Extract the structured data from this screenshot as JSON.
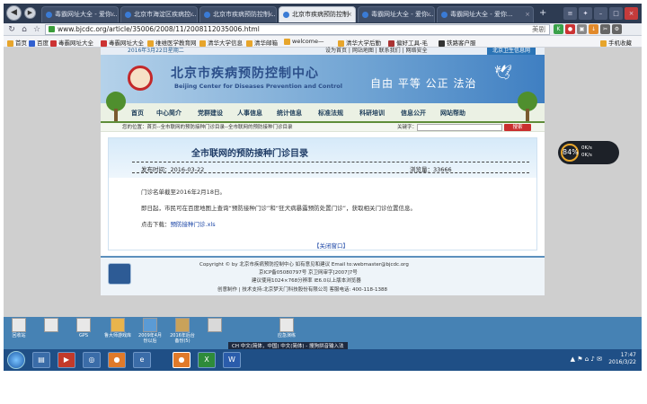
{
  "browser": {
    "tabs": [
      {
        "label": "毒霸网址大全 - 爱你..."
      },
      {
        "label": "北京市海淀区疾病控..."
      },
      {
        "label": "北京市疾病预防控制..."
      },
      {
        "label": "北京市疾病预防控制"
      },
      {
        "label": "毒霸网址大全 - 爱你..."
      },
      {
        "label": "毒霸网址大全 - 爱你..."
      }
    ],
    "active_tab": 3,
    "url": "www.bjcdc.org/article/35006/2008/11/2008112035006.html",
    "url_right_hint": "美剧",
    "bookmarks": [
      "首页",
      "百度",
      "毒霸网址大全",
      "毒霸网址大全",
      "维维医学教育网",
      "清华大学信息",
      "清华邮箱",
      "welcome—",
      "清华大学后勤",
      "偏好工具-毛",
      "铁路客户服",
      "手机收藏"
    ]
  },
  "site": {
    "date": "2016年3月22日星期二",
    "top_links": "设为首页 | 网站地图 | 联系我们 | 网络安全",
    "brand": "北京卫生信息网",
    "title_zh": "北京市疾病预防控制中心",
    "title_en": "Beijing Center for Diseases Prevention and Control",
    "slogan": "自由 平等 公正 法治",
    "nav": [
      "首页",
      "中心简介",
      "党群建设",
      "人事信息",
      "统计信息",
      "标准法规",
      "科研培训",
      "信息公开",
      "网站帮助"
    ],
    "breadcrumb": "您的位置：首页--全市联网的预防接种门诊目录--全市联网的预防接种门诊目录",
    "keyword_label": "关键字：",
    "search_button": "搜索"
  },
  "article": {
    "title": "全市联网的预防接种门诊目录",
    "published": "发布时间：2016-03-22",
    "views": "浏览量：33666",
    "para1": "门诊名单截至2016年2月18日。",
    "para2": "即日起，市民可在百度地图上查询“预防接种门诊”和“狂犬病暴露预防处置门诊”，获取相关门诊位置信息。",
    "download_label": "点击下载：",
    "download_link": "预防接种门诊.xls",
    "close_link": "【关闭窗口】"
  },
  "footer": {
    "line1": "Copyright © by 北京市疾病预防控制中心 如有意见和建议 Email to:webmaster@bjcdc.org",
    "line2": "京ICP备05080797号  京卫网审字[2007]7号",
    "line3": "建议使用1024×768分辨率 IE6.0以上版本浏览器",
    "line4": "创意制作 | 技术支持:北京梦天门科技股份有限公司 客服电话: 400-118-1388"
  },
  "widget": {
    "percent": "84%",
    "up": "0K/s",
    "down": "0K/s"
  },
  "desktop": {
    "icons": [
      "回收站",
      "",
      "GPS",
      "鲁大师游戏库",
      "2009年4月份以后",
      "2016年后台备份(5)",
      "",
      "应急演练"
    ],
    "ime": "CH 中文(简体，中国)  中文(简体) - 搜狗拼音输入法"
  },
  "taskbar": {
    "time": "17:47",
    "date": "2016/3/22"
  }
}
